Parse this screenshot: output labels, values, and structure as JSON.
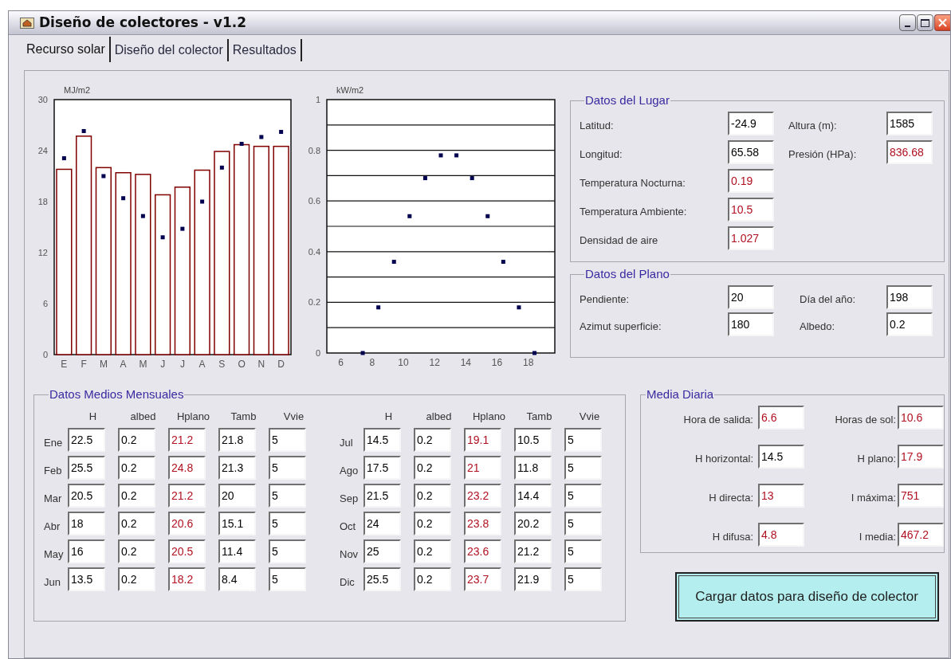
{
  "window": {
    "title": "Diseño de colectores - v1.2"
  },
  "tabs": [
    {
      "label": "Recurso solar",
      "selected": true
    },
    {
      "label": "Diseño del colector",
      "selected": false
    },
    {
      "label": "Resultados",
      "selected": false
    }
  ],
  "charts": [
    {
      "chart_data": {
        "type": "bar",
        "ylabel": "MJ/m2",
        "categories": [
          "E",
          "F",
          "M",
          "A",
          "M",
          "J",
          "J",
          "A",
          "S",
          "O",
          "N",
          "D"
        ],
        "ylim": [
          0,
          30
        ],
        "yticks": [
          0,
          6,
          12,
          18,
          24,
          30
        ],
        "series": [
          {
            "color": "#800000",
            "values": [
              21.8,
              25.7,
              22.0,
              21.4,
              21.2,
              18.8,
              19.7,
              21.7,
              23.9,
              24.7,
              24.5,
              24.5
            ]
          },
          {
            "color": "#000050",
            "type": "scatter",
            "values": [
              23.1,
              26.3,
              21.0,
              18.4,
              16.3,
              13.8,
              14.8,
              18.0,
              22.0,
              24.8,
              25.6,
              26.2
            ]
          }
        ]
      }
    },
    {
      "chart_data": {
        "type": "scatter",
        "grid": true,
        "ylabel": "kW/m2",
        "x": [
          7.4,
          8.4,
          9.4,
          10.4,
          11.4,
          12.4,
          13.4,
          14.4,
          15.4,
          16.4,
          17.4,
          18.4
        ],
        "xlim": [
          5.1,
          19.7
        ],
        "ylim": [
          0,
          1
        ],
        "xticks": [
          6,
          8,
          10,
          12,
          14,
          16,
          18
        ],
        "yticks": [
          0,
          0.2,
          0.4,
          0.6,
          0.8,
          1
        ],
        "series": [
          {
            "color": "#000050",
            "values": [
              0,
              0.18,
              0.36,
              0.54,
              0.69,
              0.78,
              0.78,
              0.69,
              0.54,
              0.36,
              0.18,
              0
            ]
          }
        ]
      }
    }
  ],
  "lugar": {
    "title": "Datos del Lugar",
    "left": [
      {
        "label": "Latitud:",
        "value": "-24.9",
        "computed": false
      },
      {
        "label": "Longitud:",
        "value": "65.58",
        "computed": false
      },
      {
        "label": "Temperatura Nocturna:",
        "value": "0.19",
        "computed": true
      },
      {
        "label": "Temperatura Ambiente:",
        "value": "10.5",
        "computed": true
      },
      {
        "label": "Densidad de aire",
        "value": "1.027",
        "computed": true
      }
    ],
    "right": [
      {
        "label": "Altura (m):",
        "value": "1585",
        "computed": false
      },
      {
        "label": "Presión (HPa):",
        "value": "836.68",
        "computed": true
      }
    ]
  },
  "plano": {
    "title": "Datos del Plano",
    "left": [
      {
        "label": "Pendiente:",
        "value": "20",
        "computed": false
      },
      {
        "label": "Azimut superficie:",
        "value": "180",
        "computed": false
      }
    ],
    "right": [
      {
        "label": "Día del año:",
        "value": "198",
        "computed": false
      },
      {
        "label": "Albedo:",
        "value": "0.2",
        "computed": false
      }
    ]
  },
  "monthly": {
    "title": "Datos Medios Mensuales",
    "halves": [
      {
        "columns": [
          {
            "label": "H",
            "computed": false
          },
          {
            "label": "albed",
            "computed": false
          },
          {
            "label": "Hplano",
            "computed": true
          },
          {
            "label": "Tamb",
            "computed": false
          },
          {
            "label": "Vvie",
            "computed": false
          }
        ],
        "rows": [
          {
            "month": "Ene",
            "cells": [
              "22.5",
              "0.2",
              "21.2",
              "21.8",
              "5"
            ]
          },
          {
            "month": "Feb",
            "cells": [
              "25.5",
              "0.2",
              "24.8",
              "21.3",
              "5"
            ]
          },
          {
            "month": "Mar",
            "cells": [
              "20.5",
              "0.2",
              "21.2",
              "20",
              "5"
            ]
          },
          {
            "month": "Abr",
            "cells": [
              "18",
              "0.2",
              "20.6",
              "15.1",
              "5"
            ]
          },
          {
            "month": "May",
            "cells": [
              "16",
              "0.2",
              "20.5",
              "11.4",
              "5"
            ]
          },
          {
            "month": "Jun",
            "cells": [
              "13.5",
              "0.2",
              "18.2",
              "8.4",
              "5"
            ]
          }
        ]
      },
      {
        "columns": [
          {
            "label": "H",
            "computed": false
          },
          {
            "label": "albed",
            "computed": false
          },
          {
            "label": "Hplano",
            "computed": true
          },
          {
            "label": "Tamb",
            "computed": false
          },
          {
            "label": "Vvie",
            "computed": false
          }
        ],
        "rows": [
          {
            "month": "Jul",
            "cells": [
              "14.5",
              "0.2",
              "19.1",
              "10.5",
              "5"
            ]
          },
          {
            "month": "Ago",
            "cells": [
              "17.5",
              "0.2",
              "21",
              "11.8",
              "5"
            ]
          },
          {
            "month": "Sep",
            "cells": [
              "21.5",
              "0.2",
              "23.2",
              "14.4",
              "5"
            ]
          },
          {
            "month": "Oct",
            "cells": [
              "24",
              "0.2",
              "23.8",
              "20.2",
              "5"
            ]
          },
          {
            "month": "Nov",
            "cells": [
              "25",
              "0.2",
              "23.6",
              "21.2",
              "5"
            ]
          },
          {
            "month": "Dic",
            "cells": [
              "25.5",
              "0.2",
              "23.7",
              "21.9",
              "5"
            ]
          }
        ]
      }
    ]
  },
  "media": {
    "title": "Media Diaria",
    "left": [
      {
        "label": "Hora de salida:",
        "value": "6.6",
        "computed": true
      },
      {
        "label": "H horizontal:",
        "value": "14.5",
        "computed": false
      },
      {
        "label": "H directa:",
        "value": "13",
        "computed": true
      },
      {
        "label": "H difusa:",
        "value": "4.8",
        "computed": true
      }
    ],
    "right": [
      {
        "label": "Horas de sol:",
        "value": "10.6",
        "computed": true
      },
      {
        "label": "H plano:",
        "value": "17.9",
        "computed": true
      },
      {
        "label": "I máxima:",
        "value": "751",
        "computed": true
      },
      {
        "label": "I media:",
        "value": "467.2",
        "computed": true
      }
    ]
  },
  "button": {
    "label": "Cargar datos para diseño de colector"
  }
}
